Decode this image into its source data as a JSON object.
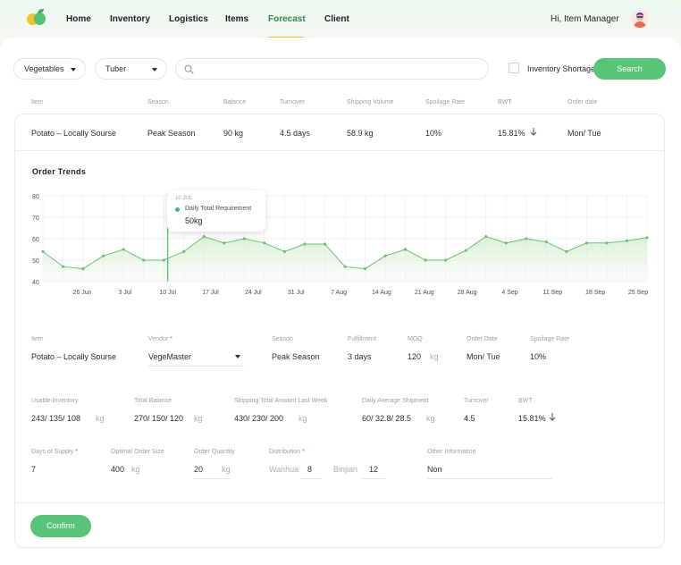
{
  "nav": {
    "items": [
      "Home",
      "Inventory",
      "Logistics",
      "Items",
      "Forecast",
      "Client"
    ],
    "active": "Forecast",
    "greeting": "Hi, Item Manager"
  },
  "filters": {
    "category": "Vegetables",
    "subcategory": "Tuber",
    "search_value": "",
    "checkbox_label": "Inventory Shortage",
    "checkbox_checked": false,
    "search_button": "Search"
  },
  "table": {
    "headers": [
      "Item",
      "Season",
      "Balance",
      "Turnover",
      "Shipping Volume",
      "Spoilage Rate",
      "BWT",
      "Order date"
    ],
    "row": [
      "Potato – Locally Sourse",
      "Peak Season",
      "90 kg",
      "4.5 days",
      "58.9 kg",
      "10%",
      "15.81%",
      "Mon/ Tue"
    ]
  },
  "chart": {
    "title": "Order Trends",
    "tooltip": {
      "date": "10 JUL",
      "label": "Daily Total Requirement",
      "value": "50kg"
    }
  },
  "chart_data": {
    "type": "area",
    "title": "Order Trends",
    "xlabel": "",
    "ylabel": "",
    "ylim": [
      40,
      80
    ],
    "yticks": [
      40,
      50,
      60,
      70,
      80
    ],
    "xticks": [
      "26 Jun",
      "3 Jul",
      "10 Jul",
      "17 Jul",
      "24 Jul",
      "31 Jul",
      "7 Aug",
      "14 Aug",
      "21 Aug",
      "28 Aug",
      "4 Sep",
      "11 Sep",
      "18 Sep",
      "25 Sep"
    ],
    "grid": true,
    "series": [
      {
        "values": [
          54,
          47,
          46,
          52,
          55,
          50,
          50,
          54,
          61,
          58,
          60,
          58,
          54,
          57.5,
          57.5,
          47,
          46,
          52,
          55,
          50,
          50,
          54.5,
          61,
          58,
          60,
          58.5,
          54,
          58,
          58,
          59,
          60.5
        ]
      }
    ],
    "highlight": {
      "x": "10 Jul",
      "value": 50
    }
  },
  "form": {
    "item_label": "Item",
    "item": "Potato – Locally Sourse",
    "vendor_label": "Vendor",
    "vendor": "VegeMaster",
    "season_label": "Season",
    "season": "Peak Season",
    "fulfillment_label": "Fulfillment",
    "fulfillment": "3 days",
    "moq_label": "MOQ",
    "moq": "120",
    "moq_unit": "kg",
    "order_date_label": "Order Date",
    "order_date": "Mon/ Tue",
    "spoilage_label": "Spoilage Rate",
    "spoilage": "10%",
    "usable_label": "Usable Inventory",
    "usable": "243/ 135/ 108",
    "usable_unit": "kg",
    "total_balance_label": "Total Balance",
    "total_balance": "270/ 150/ 120",
    "total_balance_unit": "kg",
    "shipping_total_label": "Shipping Total Amount Last Week",
    "shipping_total": "430/ 230/ 200",
    "shipping_total_unit": "kg",
    "daily_avg_label": "Daily Average Shipment",
    "daily_avg": "60/ 32.8/ 28.5",
    "daily_avg_unit": "kg",
    "turnover_label": "Turnover",
    "turnover": "4.5",
    "bwt_label": "BWT",
    "bwt": "15.81%",
    "days_supply_label": "Days of Supply",
    "days_supply": "7",
    "optimal_label": "Optimal Order Size",
    "optimal": "400",
    "optimal_unit": "kg",
    "order_qty_label": "Order Quantity",
    "order_qty": "20",
    "order_qty_unit": "kg",
    "distribution_label": "Distribution",
    "dist_a_label": "Wanhua",
    "dist_a": "8",
    "dist_b_label": "Binjian",
    "dist_b": "12",
    "other_label": "Other Information",
    "other": "Non",
    "confirm": "Confirm"
  },
  "colors": {
    "accent": "#58c47a",
    "line": "#6cc07a",
    "nav_underline": "#f2c230",
    "required": "#e35d5d"
  }
}
